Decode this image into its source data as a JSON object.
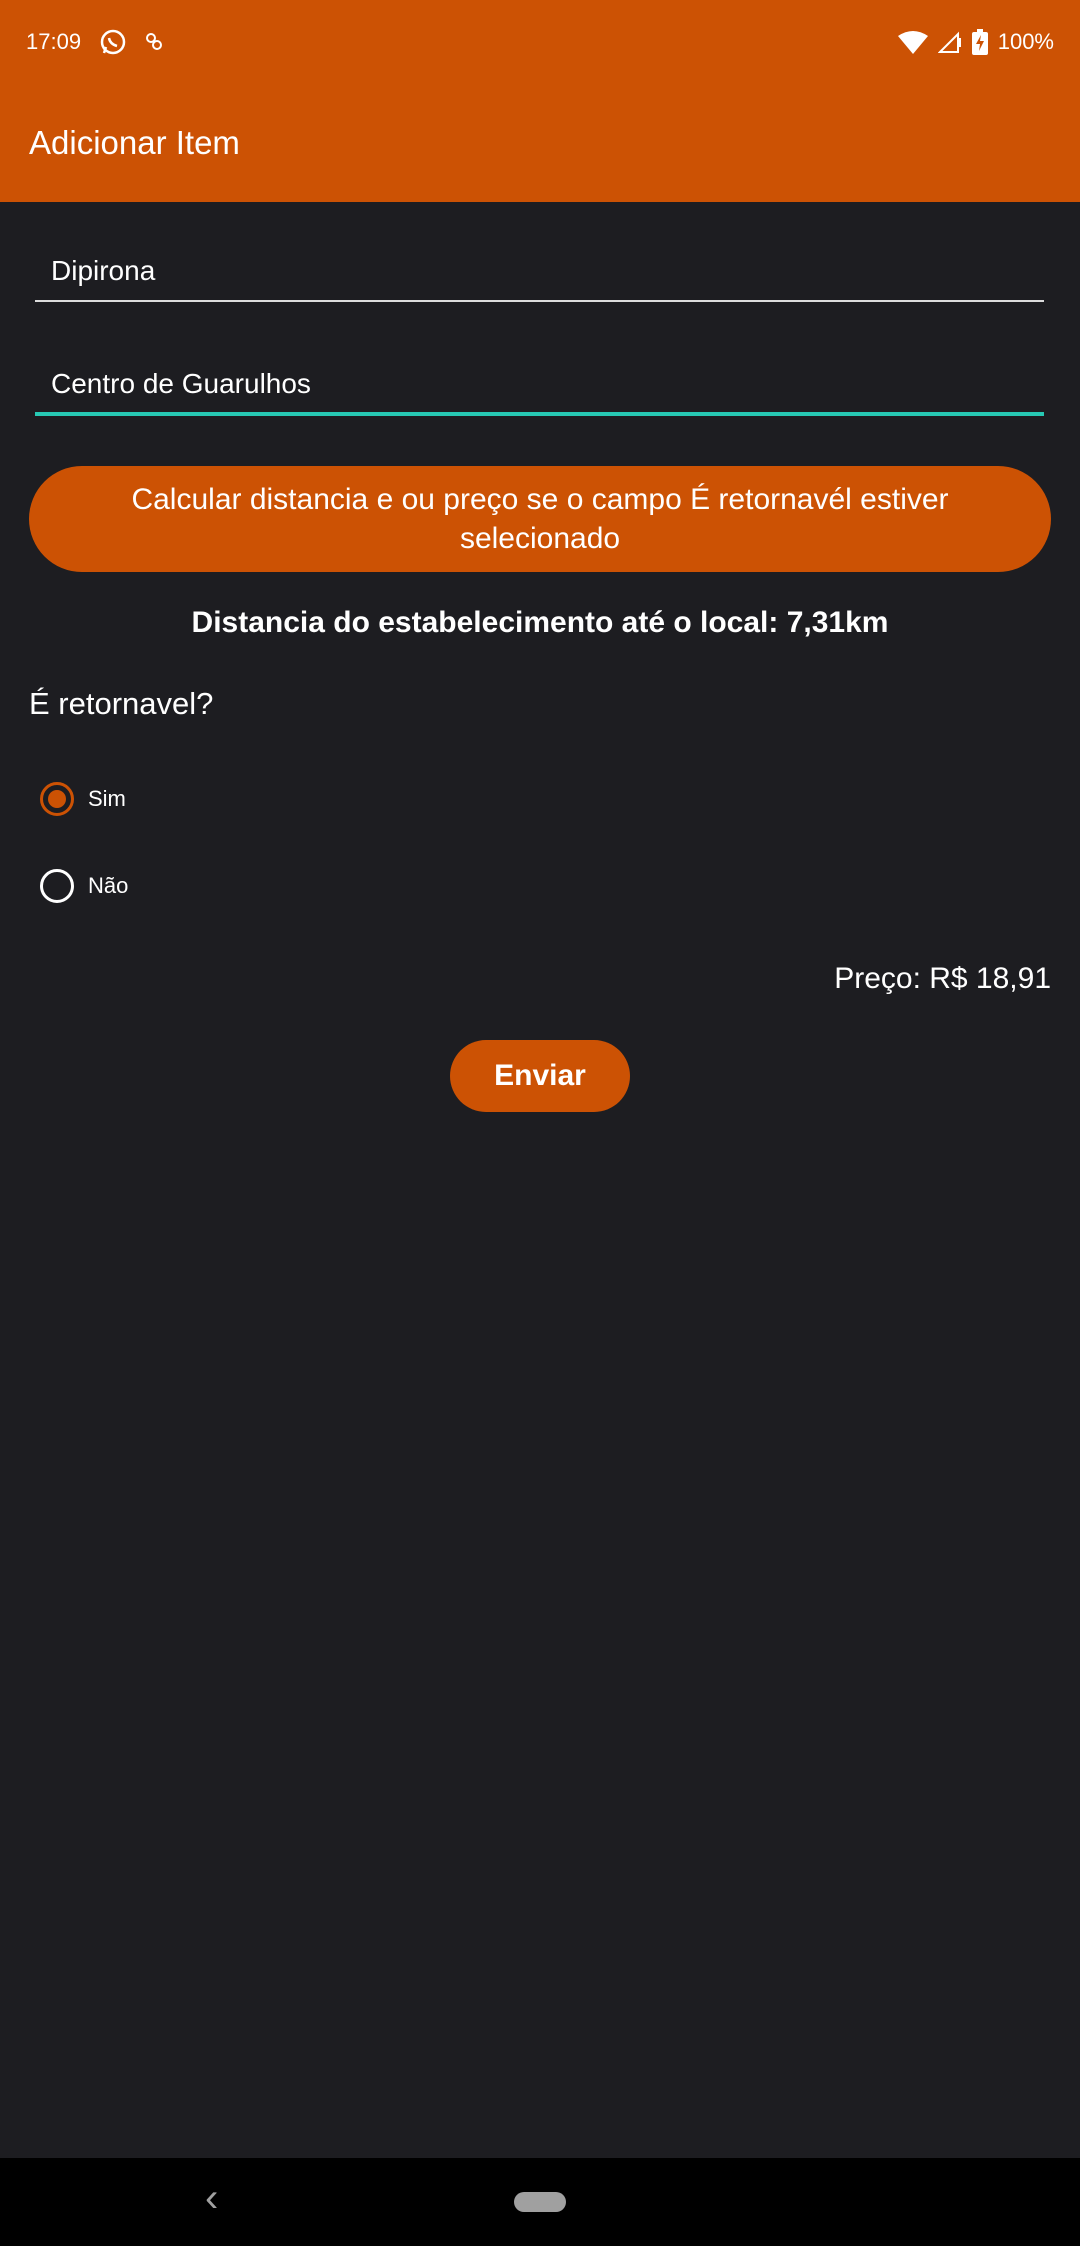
{
  "status_bar": {
    "time": "17:09",
    "battery": "100%",
    "icons": [
      "whatsapp-icon",
      "app-notification-icon",
      "wifi-icon",
      "signal-icon",
      "battery-charging-icon"
    ]
  },
  "app_bar": {
    "title": "Adicionar Item"
  },
  "form": {
    "item_name_value": "Dipirona",
    "location_value": "Centro de Guarulhos",
    "calc_button_label": "Calcular distancia e ou preço se o campo É retornavél estiver selecionado",
    "distance_text": "Distancia do estabelecimento até o local: 7,31km",
    "returnable_question": "É retornavel?",
    "options": [
      {
        "label": "Sim",
        "selected": true
      },
      {
        "label": "Não",
        "selected": false
      }
    ],
    "price_text": "Preço: R$ 18,91",
    "send_button_label": "Enviar"
  },
  "colors": {
    "accent": "#cc5204",
    "background": "#1d1d21",
    "focus_underline": "#27c9b4"
  }
}
